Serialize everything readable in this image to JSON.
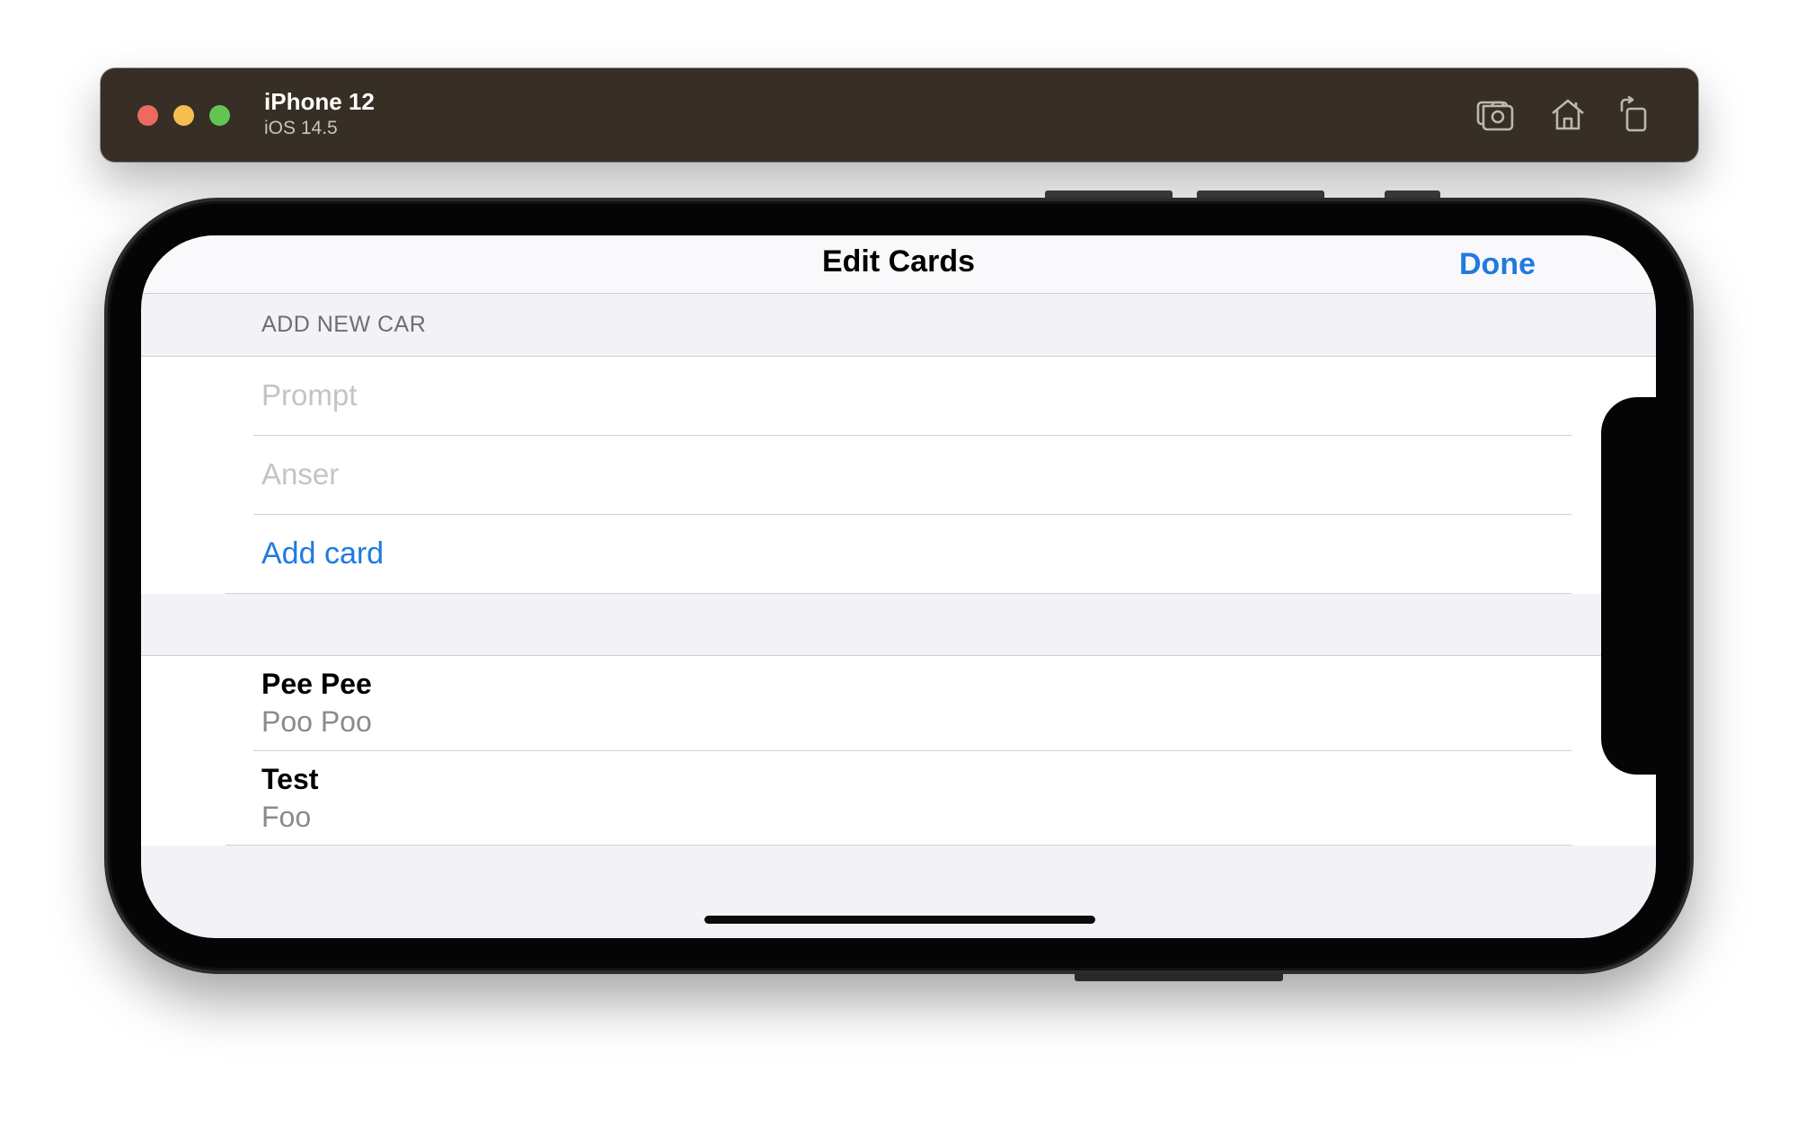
{
  "simulator": {
    "device_name": "iPhone 12",
    "os_version": "iOS 14.5",
    "toolbar_icons": [
      "screenshot-icon",
      "home-icon",
      "rotate-icon"
    ]
  },
  "navbar": {
    "title": "Edit Cards",
    "done_label": "Done"
  },
  "add_section": {
    "header": "ADD NEW CAR",
    "prompt_placeholder": "Prompt",
    "answer_placeholder": "Anser",
    "add_label": "Add card"
  },
  "cards": [
    {
      "title": "Pee Pee",
      "subtitle": "Poo Poo"
    },
    {
      "title": "Test",
      "subtitle": "Foo"
    }
  ],
  "colors": {
    "accent": "#1f7ae0",
    "titlebar": "#372e25",
    "grouped_background": "#f2f2f7"
  }
}
